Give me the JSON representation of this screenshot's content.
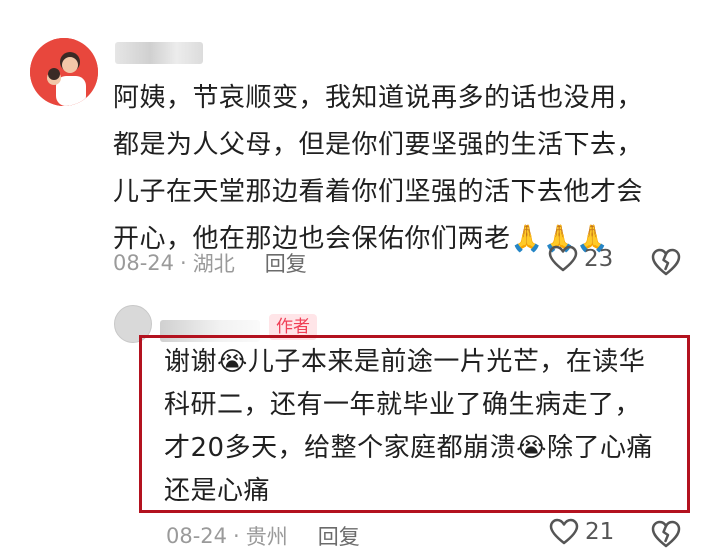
{
  "comments": [
    {
      "username": "",
      "text": "阿姨，节哀顺变，我知道说再多的话也没用，\n都是为人父母，但是你们要坚强的生活下去，\n儿子在天堂那边看着你们坚强的活下去他才会\n开心，他在那边也会保佑你们两老🙏🙏🙏",
      "date": "08-24",
      "location": "湖北",
      "reply_label": "回复",
      "like_count": "23"
    },
    {
      "username": "",
      "author_tag": "作者",
      "text": "谢谢😭儿子本来是前途一片光芒，在读华\n科研二，还有一年就毕业了确生病走了，\n才20多天，给整个家庭都崩溃😭除了心痛\n还是心痛",
      "date": "08-24",
      "location": "贵州",
      "reply_label": "回复",
      "like_count": "21"
    }
  ],
  "separator": "·",
  "colors": {
    "author_tag_bg": "#ffe5e8",
    "author_tag_text": "#f04057",
    "highlight_border": "#b3121f",
    "meta_text": "#9a9a9a"
  },
  "icons": {
    "like": "heart-outline-icon",
    "dislike": "broken-heart-icon"
  }
}
